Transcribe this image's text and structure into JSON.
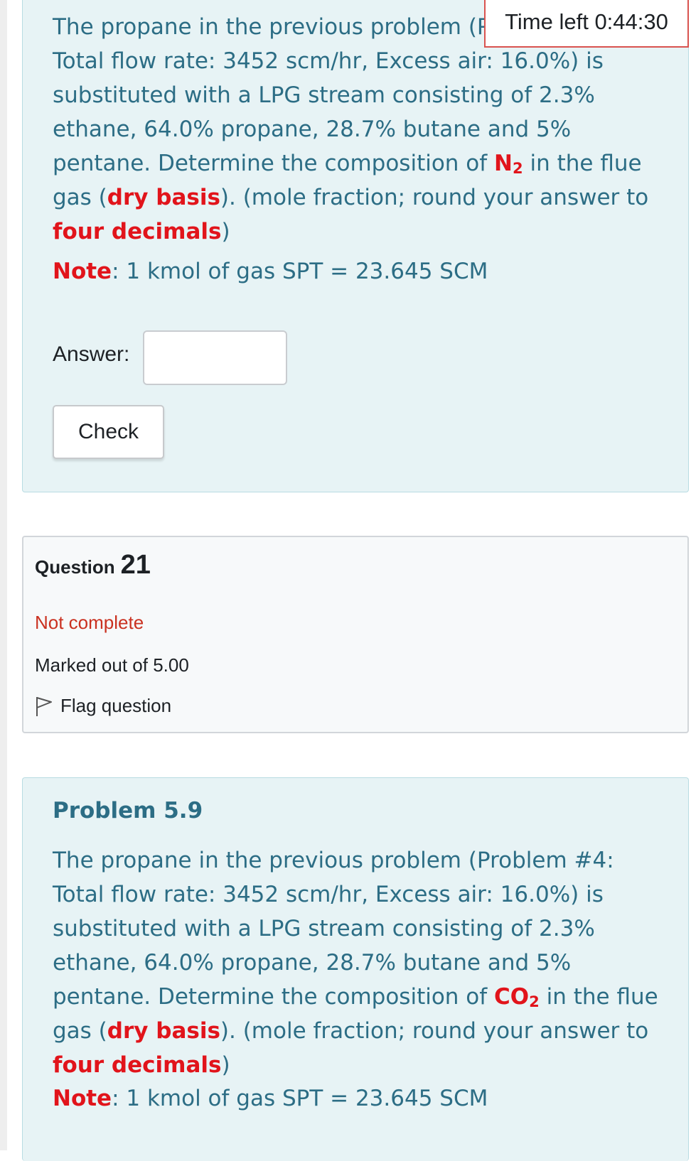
{
  "timer": {
    "label": "Time left 0:44:30"
  },
  "question_top": {
    "text_1": "The propane in the previous problem (Problem #4: Total flow rate: 3452 scm/hr,  Excess air: 16.0%) is substituted with a LPG stream consisting of 2.3% ethane, 64.0% propane, 28.7% butane and 5% pentane. Determine the composition of ",
    "species": "N",
    "species_sub": "2",
    "text_2": " in the flue gas (",
    "dry_basis": "dry basis",
    "text_3": "). (mole fraction; round your answer to ",
    "decimals": "four decimals",
    "text_4": ")",
    "note_label": "Note",
    "note_text": ": 1 kmol of gas SPT = 23.645 SCM",
    "answer_label": "Answer:",
    "answer_value": "",
    "check_label": "Check"
  },
  "question_info": {
    "question_word": "Question",
    "question_number": "21",
    "state": "Not complete",
    "grade": "Marked out of 5.00",
    "flag_label": "Flag question"
  },
  "question_bottom": {
    "title": "Problem 5.9",
    "text_1": "The propane in the previous problem (Problem #4: Total flow rate: 3452 scm/hr,  Excess air: 16.0%) is substituted with a LPG stream consisting of 2.3% ethane, 64.0% propane, 28.7% butane and 5% pentane. Determine the composition of ",
    "species": "CO",
    "species_sub": "2",
    "text_2": " in the flue gas (",
    "dry_basis": "dry basis",
    "text_3": "). (mole fraction; round your answer to ",
    "decimals": "four decimals",
    "text_4": ")",
    "note_label": "Note",
    "note_text": ": 1 kmol of gas SPT = 23.645 SCM"
  }
}
